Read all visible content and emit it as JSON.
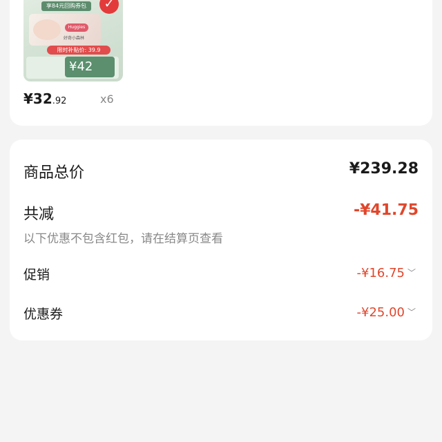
{
  "product": {
    "image_banner": "享84元回购券包",
    "image_brand": "Huggies",
    "image_tagline": "好奇小森林",
    "image_promo": "限时补贴价: 39.9",
    "image_price": "¥42",
    "check_icon": "check-icon",
    "price_symbol": "¥",
    "price_int": "32",
    "price_dec": ".92",
    "quantity": "x6"
  },
  "summary": {
    "total_label": "商品总价",
    "total_value": "¥239.28",
    "reduce_label": "共减",
    "reduce_value": "-¥41.75",
    "reduce_note": "以下优惠不包含红包，请在结算页查看",
    "promo_label": "促销",
    "promo_value": "-¥16.75",
    "coupon_label": "优惠券",
    "coupon_value": "-¥25.00",
    "chevron": "﹀"
  },
  "colors": {
    "accent_red": "#e0462b",
    "background": "#f4f4f4",
    "card": "#ffffff"
  }
}
